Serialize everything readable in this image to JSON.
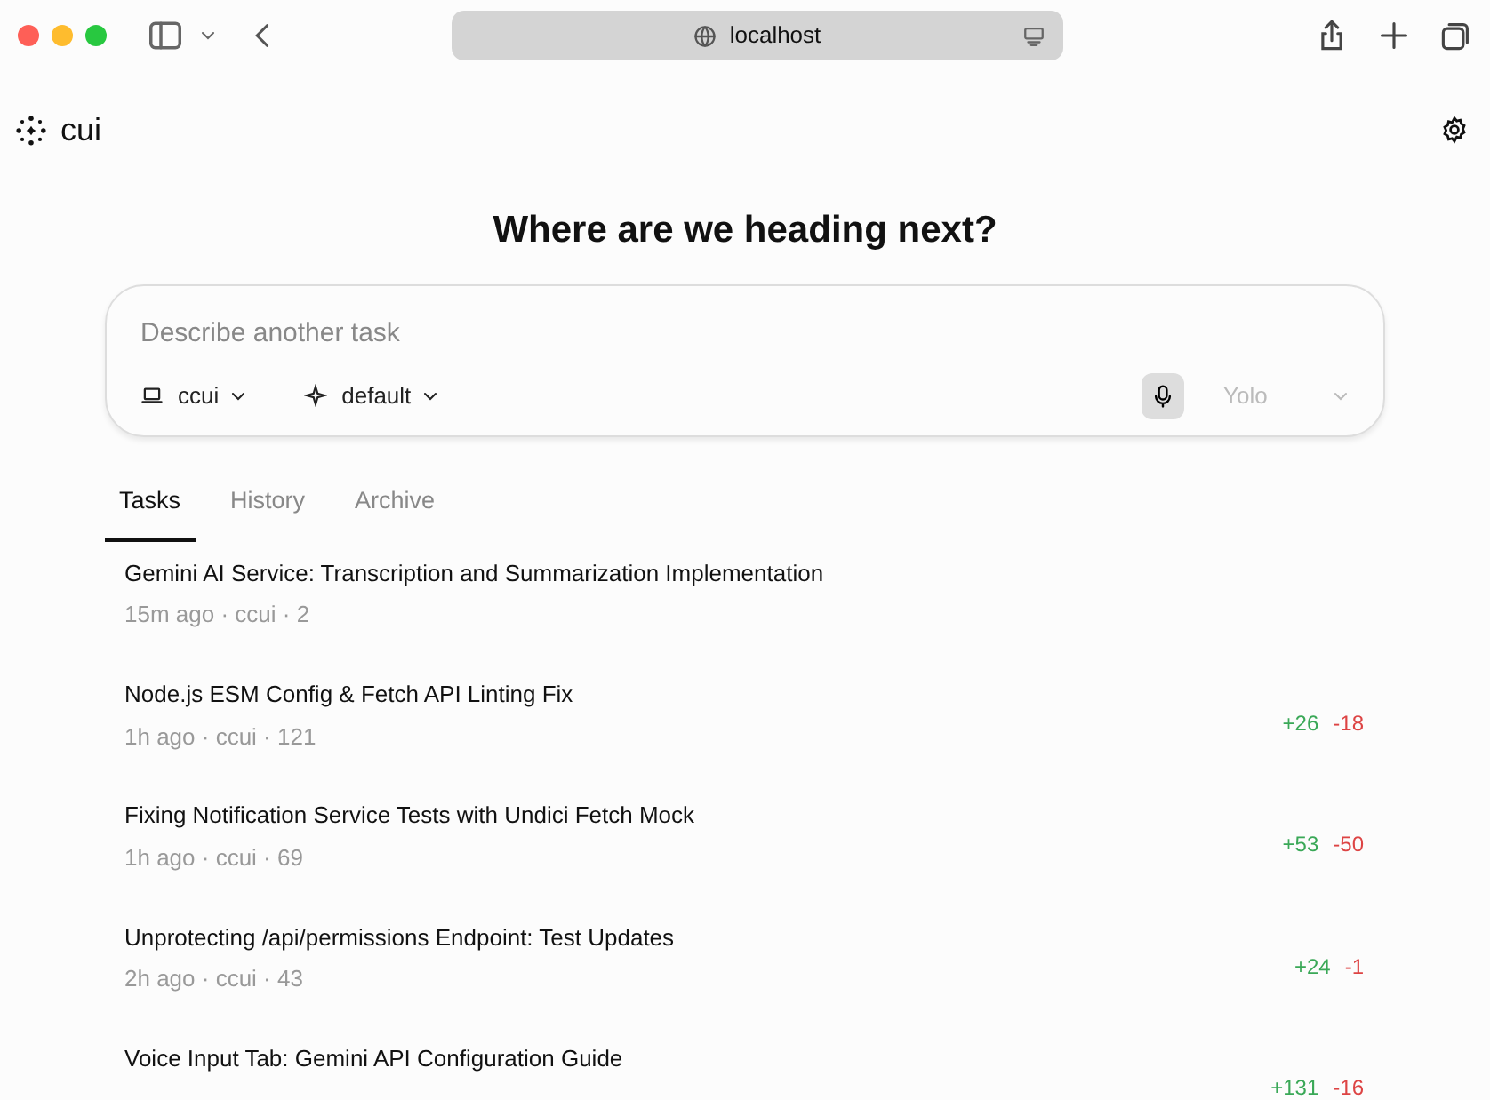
{
  "browser": {
    "url": "localhost"
  },
  "app": {
    "logo": "cui"
  },
  "heading": "Where are we heading next?",
  "composer": {
    "placeholder": "Describe another task",
    "directory": "ccui",
    "model": "default",
    "mode": {
      "label": "Yolo",
      "disabled": true
    }
  },
  "tabs": [
    {
      "label": "Tasks",
      "selected": true
    },
    {
      "label": "History",
      "selected": false
    },
    {
      "label": "Archive",
      "selected": false
    }
  ],
  "tasks": [
    {
      "title": "Gemini AI Service: Transcription and Summarization Implementation",
      "meta": "15m ago · ccui · 2"
    },
    {
      "title": "Node.js ESM Config & Fetch API Linting Fix",
      "meta": "1h ago · ccui · 121",
      "additions": "+26",
      "deletions": "-18"
    },
    {
      "title": "Fixing Notification Service Tests with Undici Fetch Mock",
      "meta": "1h ago · ccui · 69",
      "additions": "+53",
      "deletions": "-50"
    },
    {
      "title": "Unprotecting /api/permissions Endpoint: Test Updates",
      "meta": "2h ago · ccui · 43",
      "additions": "+24",
      "deletions": "-1"
    },
    {
      "title": "Voice Input Tab: Gemini API Configuration Guide",
      "additions": "+131",
      "deletions": "-16"
    }
  ]
}
